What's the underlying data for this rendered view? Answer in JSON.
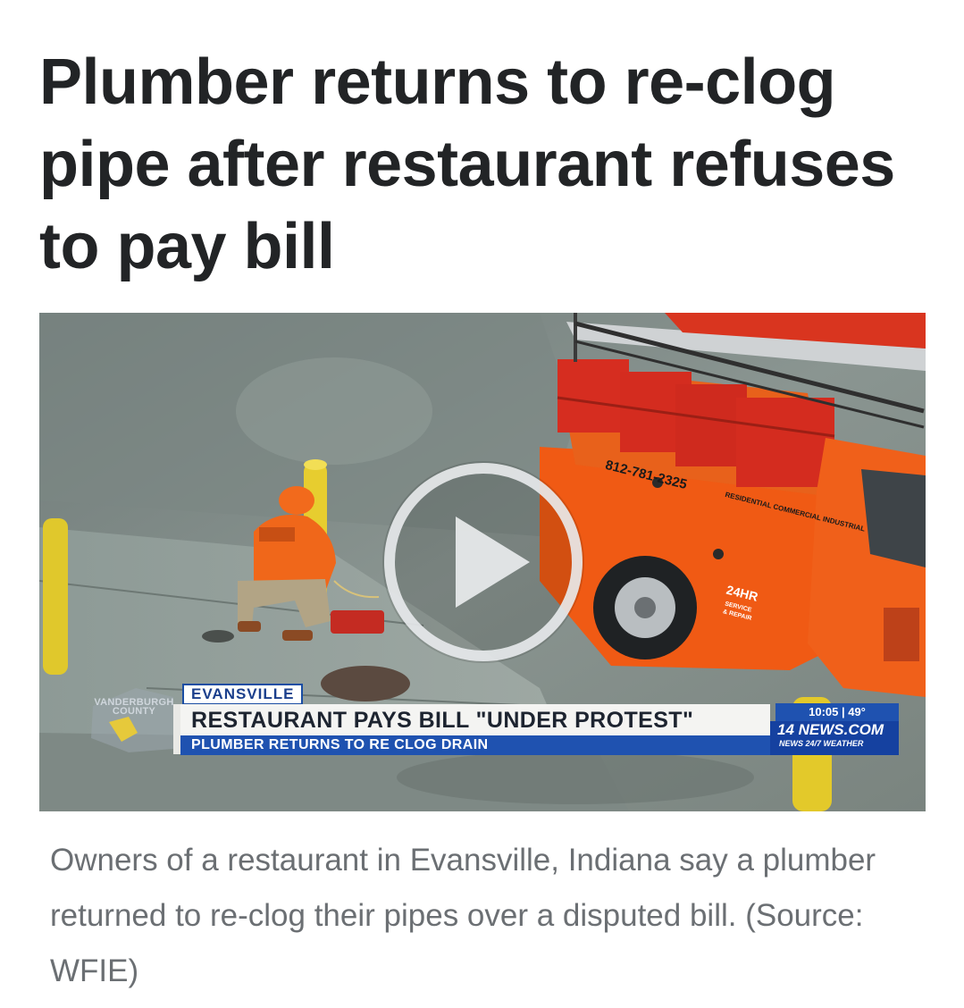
{
  "article": {
    "headline": "Plumber returns to re-clog pipe after restaurant refuses to pay bill",
    "caption": "Owners of a restaurant in Evansville, Indiana say a plumber returned to re-clog their pipes over a disputed bill. (Source: WFIE)"
  },
  "video": {
    "county_label": "VANDERBURGH COUNTY",
    "location_tag": "EVANSVILLE",
    "main_headline": "RESTAURANT PAYS BILL \"UNDER PROTEST\"",
    "sub_headline": "PLUMBER RETURNS TO RE CLOG DRAIN",
    "time_temp": "10:05 | 49°",
    "station_name": "14 NEWS.COM",
    "station_tagline": "NEWS 24/7 WEATHER",
    "truck_phone": "812-781-2325",
    "truck_services": "RESIDENTIAL COMMERCIAL INDUSTRIAL",
    "truck_badge_line1": "24HR",
    "truck_badge_line2": "SERVICE",
    "truck_badge_line3": "& REPAIR",
    "play_icon": "play-icon"
  },
  "colors": {
    "headline": "#222426",
    "caption": "#6b6f73",
    "news_blue": "#1f52b0",
    "truck_orange": "#f05a14"
  }
}
